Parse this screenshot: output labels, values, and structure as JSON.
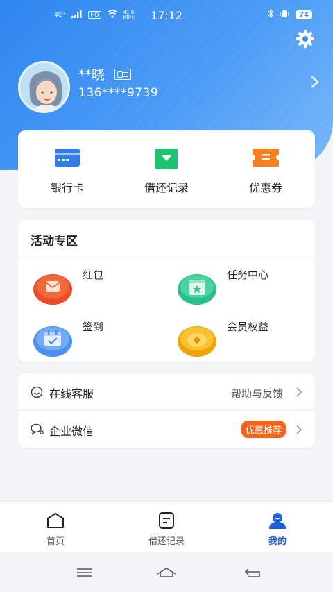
{
  "status_bar": {
    "time": "17:12",
    "network": "4G⁺",
    "hd": "HD",
    "speed": "41.6 KB/s",
    "battery": "74"
  },
  "profile": {
    "name": "**晓",
    "phone": "136****9739"
  },
  "quick_actions": [
    {
      "label": "银行卡",
      "icon": "bank-card-icon"
    },
    {
      "label": "借还记录",
      "icon": "borrow-record-icon"
    },
    {
      "label": "优惠券",
      "icon": "coupon-icon"
    }
  ],
  "activity": {
    "title": "活动专区",
    "items": [
      {
        "label": "红包",
        "icon": "red-packet-icon"
      },
      {
        "label": "任务中心",
        "icon": "task-center-icon"
      },
      {
        "label": "签到",
        "icon": "check-in-icon"
      },
      {
        "label": "会员权益",
        "icon": "member-benefits-icon"
      }
    ]
  },
  "services": {
    "online_service": {
      "label": "在线客服",
      "right_text": "帮助与反馈"
    },
    "wechat": {
      "label": "企业微信",
      "badge": "优惠推荐"
    }
  },
  "tabbar": [
    {
      "label": "首页",
      "icon": "home-icon"
    },
    {
      "label": "借还记录",
      "icon": "records-icon"
    },
    {
      "label": "我的",
      "icon": "profile-icon",
      "active": true
    }
  ],
  "colors": {
    "primary": "#2f86f0",
    "tab_active": "#1c5fd6",
    "badge": "#f3641d"
  }
}
